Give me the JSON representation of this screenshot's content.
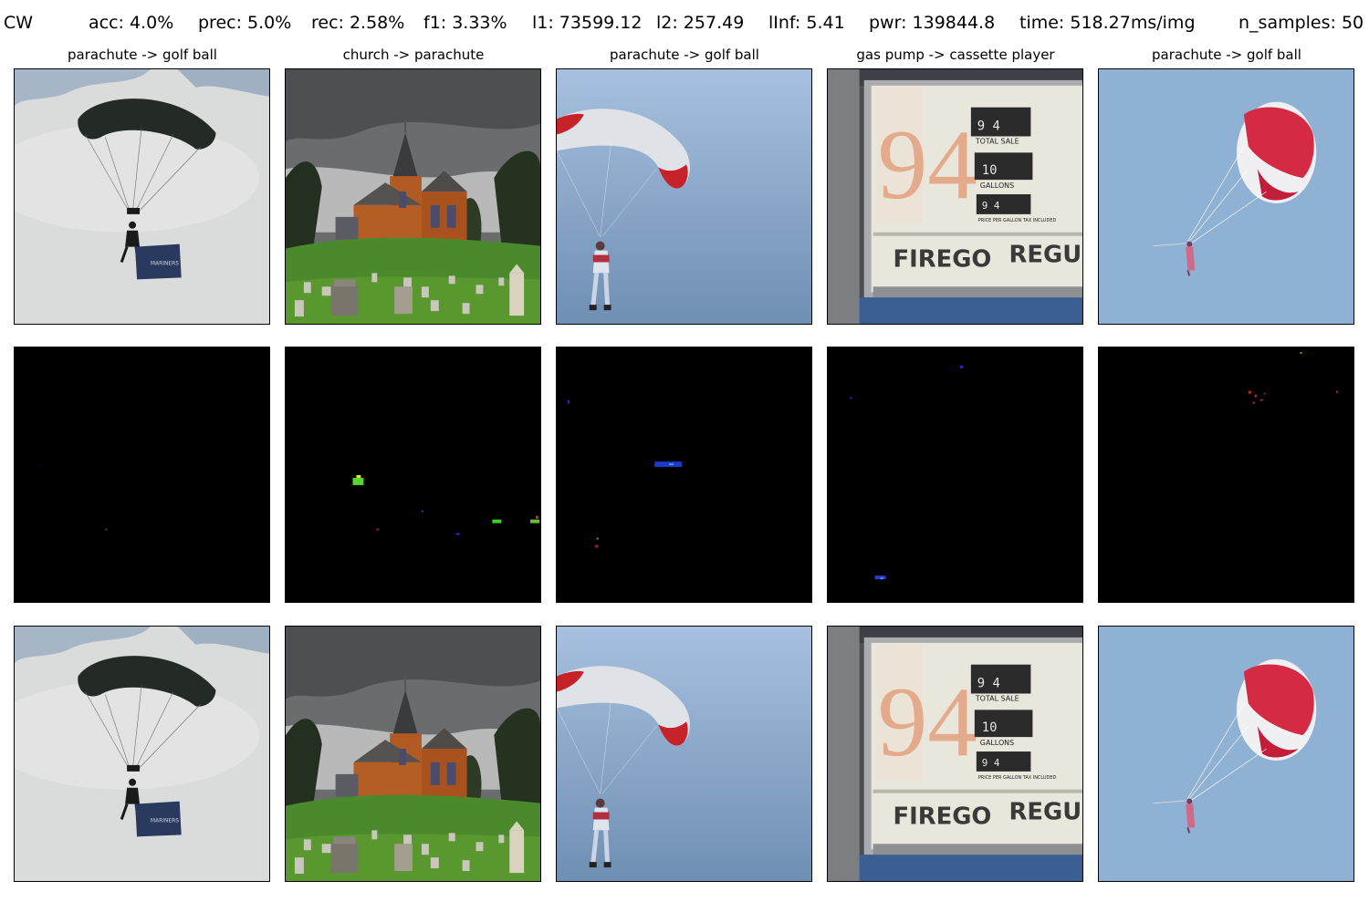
{
  "header": {
    "method": "CW",
    "acc": "acc: 4.0%",
    "prec": "prec: 5.0%",
    "rec": "rec: 2.58%",
    "f1": "f1: 3.33%",
    "l1": "l1: 73599.12",
    "l2": "l2: 257.49",
    "linf": "lInf: 5.41",
    "pwr": "pwr: 139844.8",
    "time": "time: 518.27ms/img",
    "n_samples": "n_samples: 50"
  },
  "columns": [
    {
      "title": "parachute -> golf ball",
      "original": {
        "subject": "parachutist-dark-canopy",
        "banner_text": "MARINERS"
      },
      "perturbation": {
        "subject": "near-black-noise"
      },
      "adversarial": {
        "subject": "parachutist-dark-canopy",
        "banner_text": "MARINERS"
      }
    },
    {
      "title": "church -> parachute",
      "original": {
        "subject": "brick-church-on-hill-with-graveyard"
      },
      "perturbation": {
        "subject": "sparse-green-red-blue-noise"
      },
      "adversarial": {
        "subject": "brick-church-on-hill-with-graveyard"
      }
    },
    {
      "title": "parachute -> golf ball",
      "original": {
        "subject": "skydiver-white-red-canopy"
      },
      "perturbation": {
        "subject": "sparse-blue-noise"
      },
      "adversarial": {
        "subject": "skydiver-white-red-canopy"
      }
    },
    {
      "title": "gas pump -> cassette player",
      "original": {
        "subject": "vintage-gas-pump-face",
        "price_digits": "94",
        "labels": [
          "TOTAL SALE",
          "GALLONS",
          "PRICE PER GALLON TAX INCLUDED"
        ],
        "brand_left": "FIREGO",
        "brand_right": "REGUL",
        "counter_top": "9 4",
        "counter_mid": "10",
        "counter_bottom": "9 4"
      },
      "perturbation": {
        "subject": "sparse-blue-noise"
      },
      "adversarial": {
        "subject": "vintage-gas-pump-face",
        "price_digits": "94",
        "labels": [
          "TOTAL SALE",
          "GALLONS",
          "PRICE PER GALLON TAX INCLUDED"
        ],
        "brand_left": "FIREGO",
        "brand_right": "REGUL",
        "counter_top": "9 4",
        "counter_mid": "10",
        "counter_bottom": "9 4"
      }
    },
    {
      "title": "parachute -> golf ball",
      "original": {
        "subject": "red-white-parachute-blue-sky"
      },
      "perturbation": {
        "subject": "sparse-red-noise"
      },
      "adversarial": {
        "subject": "red-white-parachute-blue-sky"
      }
    }
  ],
  "rows": [
    "original",
    "perturbation",
    "adversarial"
  ],
  "colors": {
    "background": "#ffffff",
    "perturbation_background": "#000000",
    "sky_grey": "#d8d9d9",
    "sky_blue": "#8fb0d2",
    "grass": "#4e8a2d",
    "brick": "#b85a22",
    "canopy_red": "#d4273e"
  }
}
